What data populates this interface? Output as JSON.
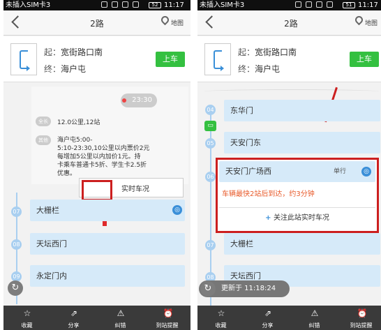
{
  "left": {
    "status": {
      "carrier": "未插入SIM卡3",
      "time": "11:17",
      "battery": "52"
    },
    "nav": {
      "title": "2路",
      "map": "地图"
    },
    "route": {
      "from_label": "起：",
      "from": "宽街路口南",
      "to_label": "终：",
      "to": "海户屯",
      "board": "上车"
    },
    "bubble_time": "23:30",
    "info": {
      "tag1": "全长",
      "length": "12.0公里,12站",
      "tag2": "其他",
      "details": [
        "海户屯5:00-",
        "5:10-23:30,10公里以内票价2元",
        "每增加5公里以内加价1元。持",
        "卡乘车普通卡5折、学生卡2.5折",
        "优惠。"
      ],
      "realtime": "实时车况"
    },
    "stops": [
      {
        "num": "07",
        "name": "大栅栏"
      },
      {
        "num": "08",
        "name": "天坛西门"
      },
      {
        "num": "09",
        "name": "永定门内"
      }
    ],
    "toolbar": [
      "收藏",
      "分享",
      "纠错",
      "到站提醒"
    ]
  },
  "right": {
    "status": {
      "carrier": "未插入SIM卡3",
      "time": "11:17",
      "battery": "51"
    },
    "nav": {
      "title": "2路",
      "map": "地图"
    },
    "route": {
      "from_label": "起：",
      "from": "宽街路口南",
      "to_label": "终：",
      "to": "海户屯",
      "board": "上车"
    },
    "stops": [
      {
        "num": "04",
        "name": "东华门"
      },
      {
        "num": "05",
        "name": "天安门东"
      },
      {
        "num": "06",
        "name": "天安门广场西",
        "tag": "单行"
      },
      {
        "num": "07",
        "name": "大栅栏"
      },
      {
        "num": "08",
        "name": "天坛西门"
      },
      {
        "num": "09",
        "name": "永定门内"
      }
    ],
    "arrival_text": "车辆最快2站后到达，约3分钟",
    "follow": "关注此站实时车况",
    "updated": "更新于 11:18:24",
    "toolbar": [
      "收藏",
      "分享",
      "纠错",
      "到站提醒"
    ]
  },
  "colors": {
    "accent": "#3a8fd8",
    "green": "#34c040",
    "highlight": "#cc1f1f"
  }
}
